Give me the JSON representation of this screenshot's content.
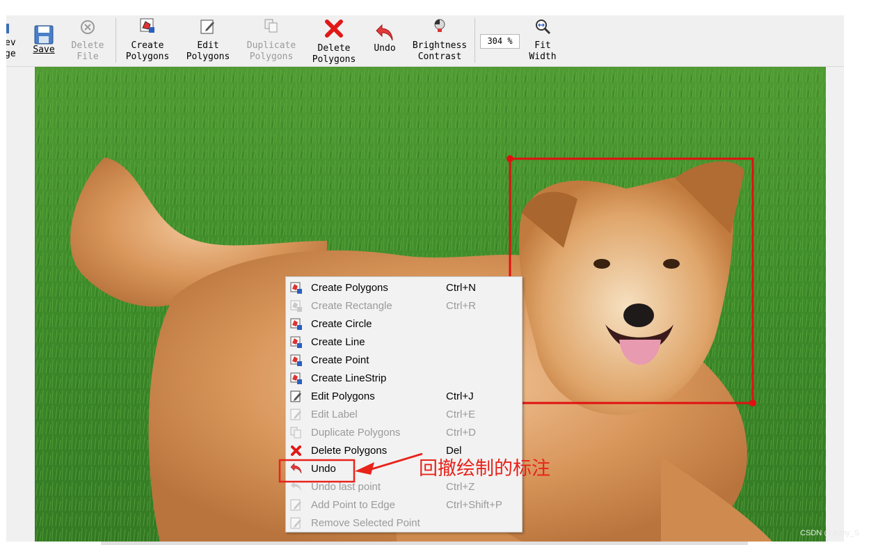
{
  "toolbar": {
    "open_clip_label": "ev\nge",
    "save_label": "Save",
    "delete_file_label": "Delete\nFile",
    "create_polygons_label": "Create\nPolygons",
    "edit_polygons_label": "Edit\nPolygons",
    "duplicate_polygons_label": "Duplicate\nPolygons",
    "delete_polygons_label": "Delete\nPolygons",
    "undo_label": "Undo",
    "brightness_contrast_label": "Brightness\nContrast",
    "zoom_value": "304 %",
    "fit_width_label": "Fit\nWidth"
  },
  "context_menu": {
    "items": [
      {
        "label": "Create Polygons",
        "shortcut": "Ctrl+N",
        "enabled": true,
        "icon": "create-polygon-icon"
      },
      {
        "label": "Create Rectangle",
        "shortcut": "Ctrl+R",
        "enabled": false,
        "icon": "create-polygon-icon"
      },
      {
        "label": "Create Circle",
        "shortcut": "",
        "enabled": true,
        "icon": "create-polygon-icon"
      },
      {
        "label": "Create Line",
        "shortcut": "",
        "enabled": true,
        "icon": "create-polygon-icon"
      },
      {
        "label": "Create Point",
        "shortcut": "",
        "enabled": true,
        "icon": "create-polygon-icon"
      },
      {
        "label": "Create LineStrip",
        "shortcut": "",
        "enabled": true,
        "icon": "create-polygon-icon"
      },
      {
        "label": "Edit Polygons",
        "shortcut": "Ctrl+J",
        "enabled": true,
        "icon": "edit-icon"
      },
      {
        "label": "Edit Label",
        "shortcut": "Ctrl+E",
        "enabled": false,
        "icon": "edit-icon"
      },
      {
        "label": "Duplicate Polygons",
        "shortcut": "Ctrl+D",
        "enabled": false,
        "icon": "duplicate-icon"
      },
      {
        "label": "Delete Polygons",
        "shortcut": "Del",
        "enabled": true,
        "icon": "delete-x-icon"
      },
      {
        "label": "Undo",
        "shortcut": "",
        "enabled": true,
        "icon": "undo-arrow-icon"
      },
      {
        "label": "Undo last point",
        "shortcut": "Ctrl+Z",
        "enabled": false,
        "icon": "undo-arrow-icon"
      },
      {
        "label": "Add Point to Edge",
        "shortcut": "Ctrl+Shift+P",
        "enabled": false,
        "icon": "edit-icon"
      },
      {
        "label": "Remove Selected Point",
        "shortcut": "",
        "enabled": false,
        "icon": "edit-icon"
      }
    ]
  },
  "annotation": {
    "text": "回撤绘制的标注",
    "color": "#e8231a"
  },
  "watermark": "CSDN @Jumy_S",
  "colors": {
    "bbox": "#e01010",
    "grass": "#3d8a2a"
  }
}
